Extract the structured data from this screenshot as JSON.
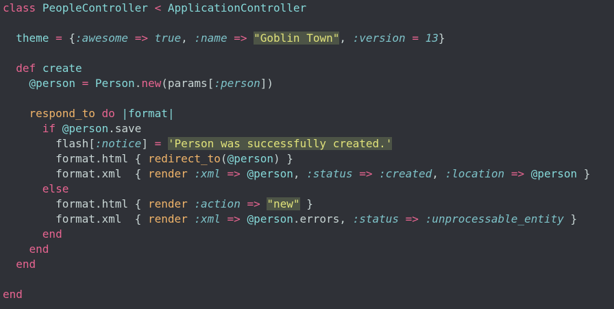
{
  "code": {
    "l1": [
      "class",
      " ",
      "PeopleController",
      " ",
      "<",
      " ",
      "ApplicationController"
    ],
    "l3": [
      "  ",
      "theme",
      " ",
      "=",
      " ",
      "{",
      ":awesome",
      " ",
      "=>",
      " ",
      "true",
      ", ",
      ":name",
      " ",
      "=>",
      " ",
      "\"Goblin Town\"",
      ", ",
      ":version",
      " ",
      "=",
      " ",
      "13",
      "}"
    ],
    "l5": [
      "  ",
      "def",
      " ",
      "create"
    ],
    "l6": [
      "    ",
      "@person",
      " ",
      "=",
      " ",
      "Person",
      ".",
      "new",
      "(",
      "params",
      "[",
      ":person",
      "])"
    ],
    "l8": [
      "    ",
      "respond_to",
      " ",
      "do",
      " ",
      "|format|"
    ],
    "l9": [
      "      ",
      "if",
      " ",
      "@person",
      ".save"
    ],
    "l10": [
      "        ",
      "flash",
      "[",
      ":notice",
      "]",
      " ",
      "=",
      " ",
      "'Person was successfully created.'"
    ],
    "l11": [
      "        ",
      "format.html",
      " ",
      "{",
      " ",
      "redirect_to",
      "(",
      "@person",
      ")",
      " ",
      "}"
    ],
    "l12": [
      "        ",
      "format.xml",
      "  ",
      "{",
      " ",
      "render",
      " ",
      ":xml",
      " ",
      "=>",
      " ",
      "@person",
      ", ",
      ":status",
      " ",
      "=>",
      " ",
      ":created",
      ", ",
      ":location",
      " ",
      "=>",
      " ",
      "@person",
      " ",
      "}"
    ],
    "l13": [
      "      ",
      "else"
    ],
    "l14": [
      "        ",
      "format.html",
      " ",
      "{",
      " ",
      "render",
      " ",
      ":action",
      " ",
      "=>",
      " ",
      "\"new\"",
      " ",
      "}"
    ],
    "l15": [
      "        ",
      "format.xml",
      "  ",
      "{",
      " ",
      "render",
      " ",
      ":xml",
      " ",
      "=>",
      " ",
      "@person",
      ".errors",
      ", ",
      ":status",
      " ",
      "=>",
      " ",
      ":unprocessable_entity",
      " ",
      "}"
    ],
    "l16": [
      "      ",
      "end"
    ],
    "l17": [
      "    ",
      "end"
    ],
    "l18": [
      "  ",
      "end"
    ],
    "l20": [
      "end"
    ]
  }
}
